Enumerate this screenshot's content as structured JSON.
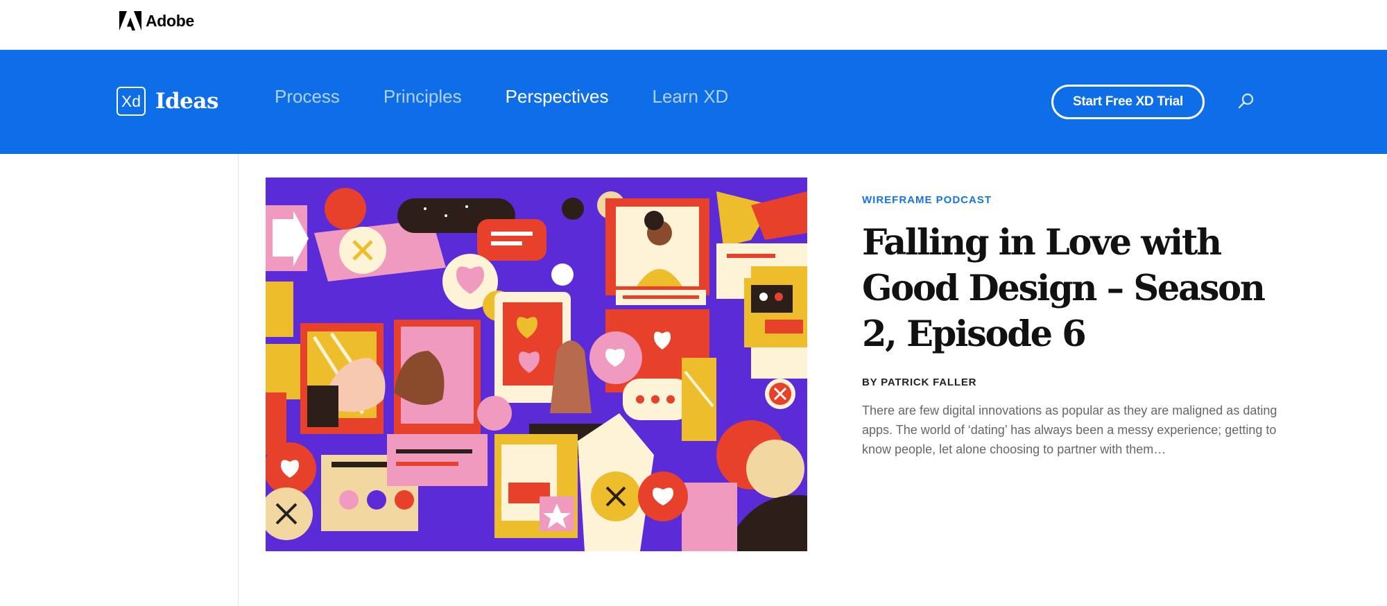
{
  "adobe_bar": {
    "brand": "Adobe"
  },
  "nav": {
    "brand_mark": "Xd",
    "brand_name": "Ideas",
    "links": [
      "Process",
      "Principles",
      "Perspectives",
      "Learn XD"
    ],
    "active_link": "Perspectives",
    "cta_label": "Start Free XD Trial"
  },
  "article": {
    "category": "WIREFRAME PODCAST",
    "title": "Falling in Love with Good Design – Season 2, Episode 6",
    "byline": "BY PATRICK FALLER",
    "excerpt": "There are few digital innovations as popular as they are maligned as dating apps. The world of ‘dating’ has always been a messy experience; getting to know people, let alone choosing to partner with them…"
  },
  "colors": {
    "nav_blue": "#0d6ee8",
    "category_blue": "#1473e6",
    "hero_purple": "#5a2bd6"
  },
  "icons": [
    "adobe-logo-icon",
    "xd-logo-icon",
    "search-icon"
  ]
}
